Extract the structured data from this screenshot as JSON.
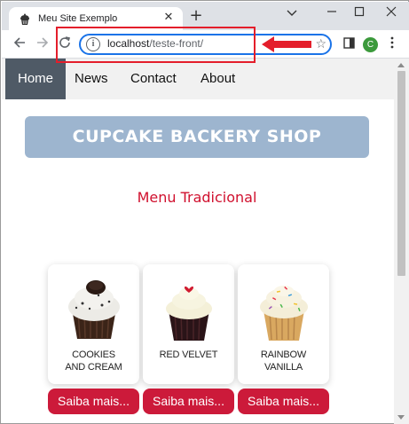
{
  "browser": {
    "tab_title": "Meu Site Exemplo",
    "tab_close": "✕",
    "new_tab": "+",
    "url_host": "localhost",
    "url_path": "/teste-front/",
    "profile_initial": "C",
    "icons": [
      "cupcake-favicon",
      "back-arrow-icon",
      "forward-arrow-icon",
      "reload-icon",
      "info-icon",
      "star-icon",
      "side-panel-icon",
      "profile-avatar",
      "more-menu-icon",
      "minimize-icon",
      "maximize-icon",
      "close-window-icon",
      "chevron-down-icon"
    ],
    "annotation_color": "#e41e2b"
  },
  "site": {
    "nav": [
      {
        "label": "Home",
        "active": true
      },
      {
        "label": "News",
        "active": false
      },
      {
        "label": "Contact",
        "active": false
      },
      {
        "label": "About",
        "active": false
      }
    ],
    "banner": "CUPCAKE BACKERY SHOP",
    "section_title": "Menu Tradicional",
    "products": [
      {
        "name": "COOKIES\nAND CREAM",
        "button": "Saiba mais..."
      },
      {
        "name": "RED VELVET",
        "button": "Saiba mais..."
      },
      {
        "name": "RAINBOW\nVANILLA",
        "button": "Saiba mais..."
      }
    ],
    "colors": {
      "nav_active": "#4f5a66",
      "banner": "#9db5cf",
      "title": "#d0102e",
      "button": "#cc1a3a"
    }
  }
}
